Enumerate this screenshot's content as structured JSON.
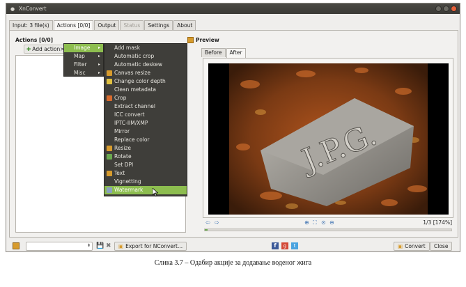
{
  "window": {
    "title": "XnConvert"
  },
  "tabs": [
    {
      "label": "Input: 3 file(s)",
      "state": "normal"
    },
    {
      "label": "Actions [0/0]",
      "state": "active"
    },
    {
      "label": "Output",
      "state": "normal"
    },
    {
      "label": "Status",
      "state": "disabled"
    },
    {
      "label": "Settings",
      "state": "normal"
    },
    {
      "label": "About",
      "state": "normal"
    }
  ],
  "actions": {
    "title": "Actions [0/0]",
    "add_label": "Add action>"
  },
  "preview": {
    "title": "Preview",
    "tabs": [
      {
        "label": "Before",
        "active": false
      },
      {
        "label": "After",
        "active": true
      }
    ],
    "page_info": "1/3 [174%]",
    "progress": 0.01,
    "image_text": "J.P.G."
  },
  "menu": {
    "categories": [
      {
        "label": "Image",
        "highlighted": true
      },
      {
        "label": "Map",
        "highlighted": false
      },
      {
        "label": "Filter",
        "highlighted": false
      },
      {
        "label": "Misc",
        "highlighted": false
      }
    ],
    "image_items": [
      {
        "label": "Add mask",
        "icon": "",
        "highlighted": false
      },
      {
        "label": "Automatic crop",
        "icon": "",
        "highlighted": false
      },
      {
        "label": "Automatic deskew",
        "icon": "",
        "highlighted": false
      },
      {
        "label": "Canvas resize",
        "icon": "canvas-icon",
        "highlighted": false
      },
      {
        "label": "Change color depth",
        "icon": "palette-icon",
        "highlighted": false
      },
      {
        "label": "Clean metadata",
        "icon": "",
        "highlighted": false
      },
      {
        "label": "Crop",
        "icon": "crop-icon",
        "highlighted": false
      },
      {
        "label": "Extract channel",
        "icon": "",
        "highlighted": false
      },
      {
        "label": "ICC convert",
        "icon": "",
        "highlighted": false
      },
      {
        "label": "IPTC-IIM/XMP",
        "icon": "",
        "highlighted": false
      },
      {
        "label": "Mirror",
        "icon": "",
        "highlighted": false
      },
      {
        "label": "Replace color",
        "icon": "",
        "highlighted": false
      },
      {
        "label": "Resize",
        "icon": "resize-icon",
        "highlighted": false
      },
      {
        "label": "Rotate",
        "icon": "rotate-icon",
        "highlighted": false
      },
      {
        "label": "Set DPI",
        "icon": "",
        "highlighted": false
      },
      {
        "label": "Text",
        "icon": "text-icon",
        "highlighted": false
      },
      {
        "label": "Vignetting",
        "icon": "",
        "highlighted": false
      },
      {
        "label": "Watermark",
        "icon": "watermark-icon",
        "highlighted": true
      }
    ]
  },
  "bottom": {
    "export_label": "Export for NConvert...",
    "convert_label": "Convert",
    "close_label": "Close"
  },
  "caption": "Слика 3.7 – Одабир акције за додавање воденог жига",
  "colors": {
    "menu_bg": "#3f3e3a",
    "highlight": "#8dbd4f",
    "titlebar": "#3b3a36"
  }
}
